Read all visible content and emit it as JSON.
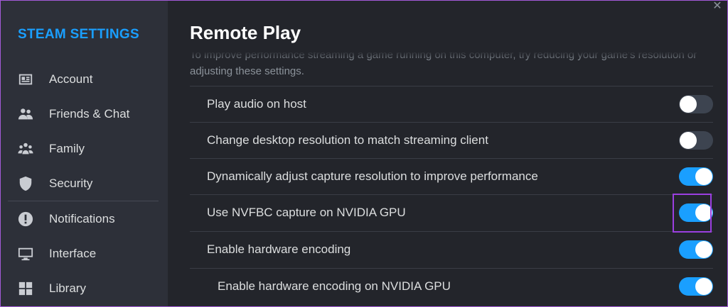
{
  "sidebar": {
    "title": "STEAM SETTINGS",
    "items": [
      {
        "label": "Account",
        "icon": "account-card-icon"
      },
      {
        "label": "Friends & Chat",
        "icon": "friends-icon"
      },
      {
        "label": "Family",
        "icon": "family-icon"
      },
      {
        "label": "Security",
        "icon": "shield-icon"
      },
      {
        "label": "Notifications",
        "icon": "exclamation-circle-icon"
      },
      {
        "label": "Interface",
        "icon": "monitor-icon"
      },
      {
        "label": "Library",
        "icon": "grid-icon"
      }
    ]
  },
  "main": {
    "title": "Remote Play",
    "description": "To improve performance streaming a game running on this computer, try reducing your game's resolution or adjusting these settings.",
    "settings": [
      {
        "label": "Play audio on host",
        "enabled": false
      },
      {
        "label": "Change desktop resolution to match streaming client",
        "enabled": false
      },
      {
        "label": "Dynamically adjust capture resolution to improve performance",
        "enabled": true
      },
      {
        "label": "Use NVFBC capture on NVIDIA GPU",
        "enabled": true
      },
      {
        "label": "Enable hardware encoding",
        "enabled": true
      },
      {
        "label": "Enable hardware encoding on NVIDIA GPU",
        "enabled": true
      }
    ]
  },
  "window": {
    "close_glyph": "✕"
  },
  "colors": {
    "accent": "#1a9fff",
    "highlight": "#9b3fe0",
    "sidebar_bg": "#2d3039",
    "main_bg": "#23252b"
  }
}
